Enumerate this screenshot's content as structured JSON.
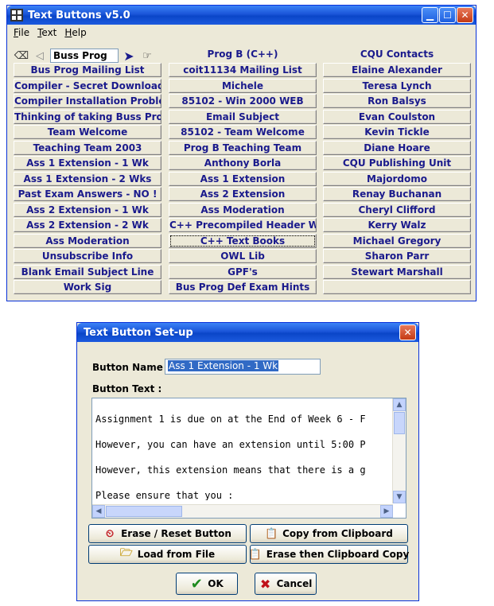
{
  "main_window": {
    "title": "Text Buttons v5.0",
    "menu": [
      {
        "label": "File",
        "accel": "F",
        "rest": "ile"
      },
      {
        "label": "Text",
        "accel": "T",
        "rest": "ext"
      },
      {
        "label": "Help",
        "accel": "H",
        "rest": "elp"
      }
    ],
    "name_input": "Buss Prog",
    "column_headers": [
      "Prog B (C++)",
      "CQU Contacts"
    ],
    "columns": [
      [
        "Bus Prog Mailing List",
        "Compiler - Secret Download",
        "Compiler Installation Problems",
        "Thinking of taking Buss Prog",
        "Team Welcome",
        "Teaching Team 2003",
        "Ass 1 Extension - 1 Wk",
        "Ass 1 Extension - 2 Wks",
        "Past Exam Answers - NO !",
        "Ass 2 Extension - 1 Wk",
        "Ass 2 Extension - 2 Wk",
        "Ass Moderation",
        "Unsubscribe Info",
        "Blank Email Subject Line",
        "Work Sig"
      ],
      [
        "coit11134 Mailing List",
        "Michele",
        "85102 - Win 2000 WEB",
        "Email Subject",
        "85102 - Team Welcome",
        "Prog B Teaching Team",
        "Anthony Borla",
        "Ass 1 Extension",
        "Ass 2 Extension",
        "Ass Moderation",
        "C++ Precompiled Header Warning",
        "C++ Text Books",
        "OWL Lib",
        "GPF's",
        "Bus Prog Def Exam Hints"
      ],
      [
        "Elaine Alexander",
        "Teresa Lynch",
        "Ron Balsys",
        "Evan Coulston",
        "Kevin Tickle",
        "Diane Hoare",
        "CQU Publishing Unit",
        "Majordomo",
        "Renay Buchanan",
        "Cheryl Clifford",
        "Kerry Walz",
        "Michael Gregory",
        "Sharon Parr",
        "Stewart Marshall",
        ""
      ]
    ]
  },
  "dialog": {
    "title": "Text Button Set-up",
    "button_name_label": "Button Name :",
    "button_name_value": "Ass 1 Extension - 1 Wk",
    "button_text_label": "Button Text :",
    "text_lines": [
      "Assignment 1 is due on at the End of Week 6 - F",
      "However, you can have an extension until 5:00 P",
      "However, this extension means that there is a g",
      "Please ensure that you :"
    ],
    "buttons": {
      "erase_reset": "Erase / Reset Button",
      "copy_clipboard": "Copy from Clipboard",
      "load_file": "Load from File",
      "erase_copy": "Erase then Clipboard Copy",
      "ok": "OK",
      "cancel": "Cancel"
    }
  },
  "colors": {
    "title_blue": "#0a46c8",
    "button_text": "#1a1a8c",
    "window_face": "#ece9d8"
  }
}
